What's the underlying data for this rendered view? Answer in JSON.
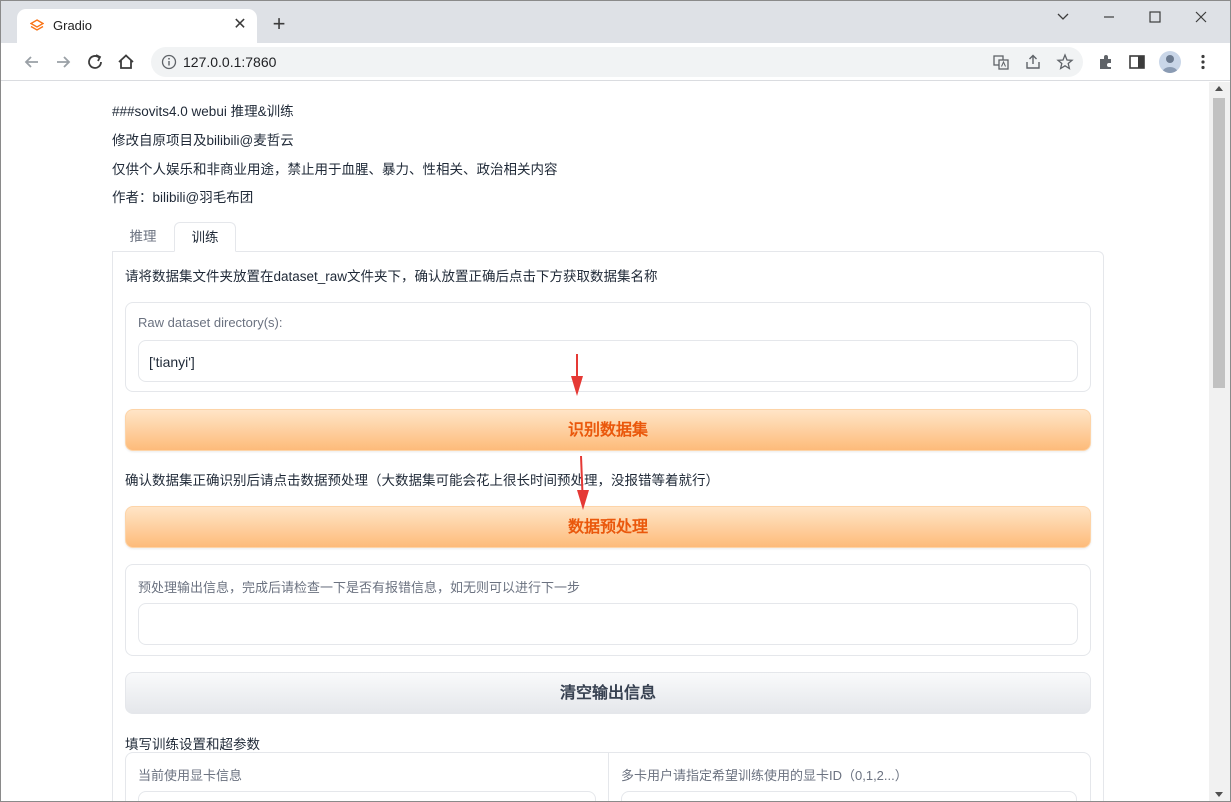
{
  "browser": {
    "tab_title": "Gradio",
    "url": "127.0.0.1:7860",
    "new_tab_symbol": "+",
    "close_symbol": "✕"
  },
  "intro": {
    "line1": "###sovits4.0 webui 推理&训练",
    "line2": "修改自原项目及bilibili@麦哲云",
    "line3": "仅供个人娱乐和非商业用途，禁止用于血腥、暴力、性相关、政治相关内容",
    "line4": "作者：bilibili@羽毛布团"
  },
  "tabs": [
    {
      "label": "推理",
      "selected": false
    },
    {
      "label": "训练",
      "selected": true
    }
  ],
  "train": {
    "instruction": "请将数据集文件夹放置在dataset_raw文件夹下，确认放置正确后点击下方获取数据集名称",
    "raw_dir_label": "Raw dataset directory(s):",
    "raw_dir_value": "['tianyi']",
    "identify_button": "识别数据集",
    "preprocess_hint": "确认数据集正确识别后请点击数据预处理（大数据集可能会花上很长时间预处理，没报错等着就行）",
    "preprocess_button": "数据预处理",
    "output_label": "预处理输出信息，完成后请检查一下是否有报错信息，如无则可以进行下一步",
    "output_value": "",
    "clear_button": "清空输出信息",
    "settings_heading": "填写训练设置和超参数",
    "gpu_info_label": "当前使用显卡信息",
    "gpu_id_label": "多卡用户请指定希望训练使用的显卡ID（0,1,2...）"
  },
  "colors": {
    "primary_button_text": "#ea580c",
    "annotation_arrow": "#e53935"
  }
}
